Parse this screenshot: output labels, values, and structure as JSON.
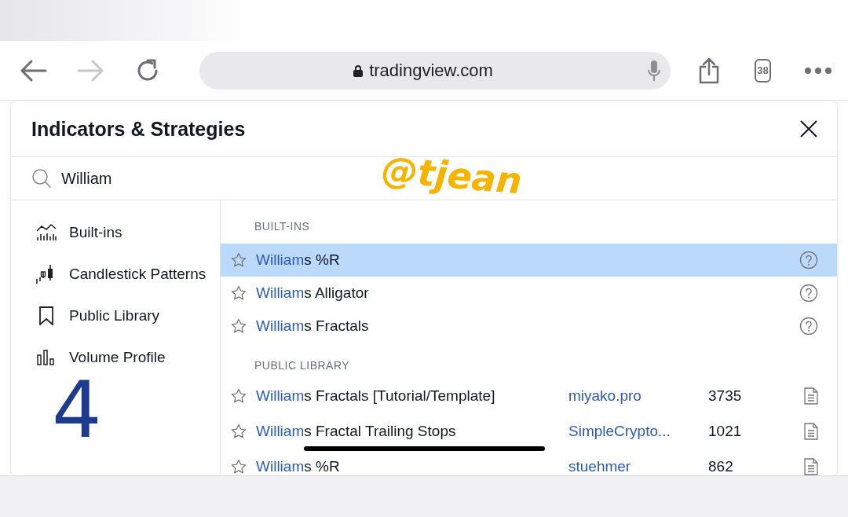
{
  "browser": {
    "url": "tradingview.com",
    "tab_count": "38",
    "forward_disabled": true
  },
  "dialog": {
    "title": "Indicators & Strategies",
    "search": {
      "value": "William"
    },
    "sidebar": [
      {
        "label": "Built-ins"
      },
      {
        "label": "Candlestick Patterns"
      },
      {
        "label": "Public Library"
      },
      {
        "label": "Volume Profile"
      }
    ],
    "sections": [
      {
        "heading": "BUILT-INS",
        "rows": [
          {
            "kind": "builtin",
            "match": "William",
            "rest": "s %R",
            "selected": true
          },
          {
            "kind": "builtin",
            "match": "William",
            "rest": "s Alligator",
            "selected": false
          },
          {
            "kind": "builtin",
            "match": "William",
            "rest": "s Fractals",
            "selected": false
          }
        ]
      },
      {
        "heading": "PUBLIC LIBRARY",
        "rows": [
          {
            "kind": "public",
            "match": "William",
            "rest": "s Fractals [Tutorial/Template]",
            "author": "miyako.pro",
            "count": "3735",
            "selected": false
          },
          {
            "kind": "public",
            "match": "William",
            "rest": "s Fractal Trailing Stops",
            "author": "SimpleCrypto...",
            "count": "1021",
            "selected": false
          },
          {
            "kind": "public",
            "match": "William",
            "rest": "s %R",
            "author": "stuehmer",
            "count": "862",
            "selected": false
          }
        ]
      }
    ]
  },
  "annotations": [
    {
      "kind": "handle",
      "text": "@tjean"
    },
    {
      "kind": "digit",
      "text": "4"
    }
  ]
}
